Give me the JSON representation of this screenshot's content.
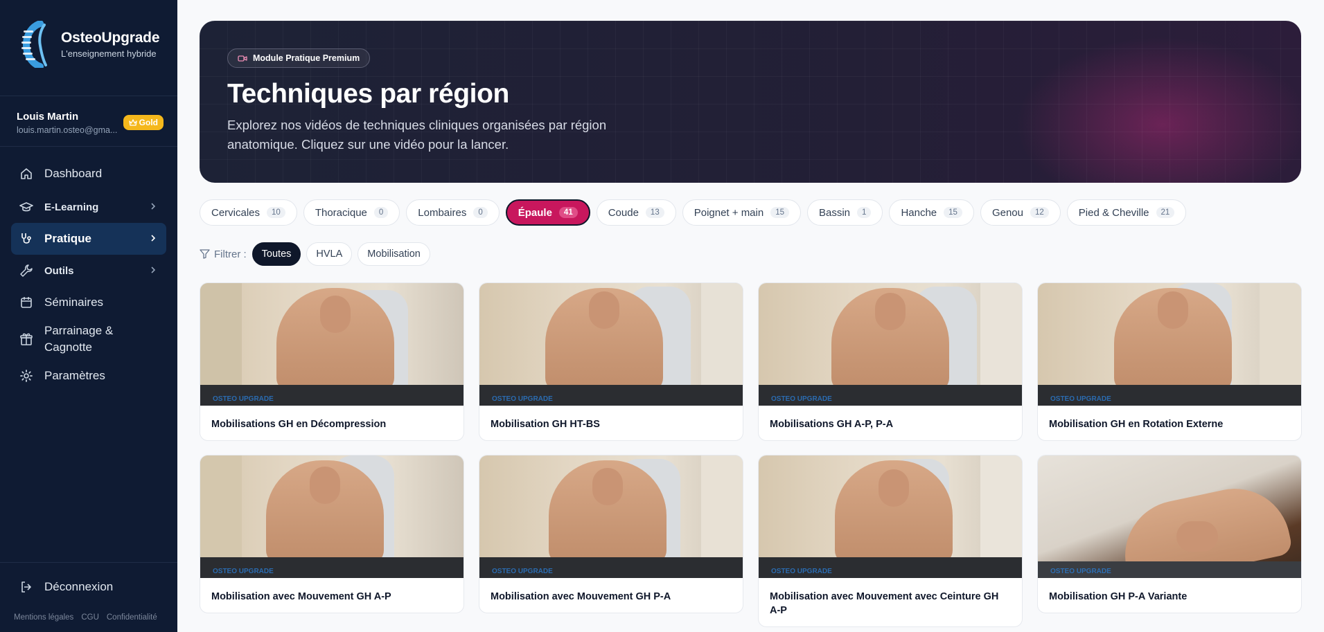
{
  "brand": {
    "name": "OsteoUpgrade",
    "tagline": "L'enseignement hybride"
  },
  "user": {
    "name": "Louis Martin",
    "email": "louis.martin.osteo@gma...",
    "badge": "Gold",
    "badge_color": "#f5b81c"
  },
  "nav": {
    "items": [
      {
        "label": "Dashboard"
      },
      {
        "label": "E-Learning"
      },
      {
        "label": "Pratique"
      },
      {
        "label": "Outils"
      },
      {
        "label": "Séminaires"
      },
      {
        "label": "Parrainage & Cagnotte"
      },
      {
        "label": "Paramètres"
      }
    ],
    "logout": "Déconnexion",
    "legal": [
      "Mentions légales",
      "CGU",
      "Confidentialité"
    ]
  },
  "hero": {
    "pill": "Module Pratique Premium",
    "title": "Techniques par région",
    "subtitle": "Explorez nos vidéos de techniques cliniques organisées par région anatomique. Cliquez sur une vidéo pour la lancer."
  },
  "regions": [
    {
      "label": "Cervicales",
      "count": "10"
    },
    {
      "label": "Thoracique",
      "count": "0"
    },
    {
      "label": "Lombaires",
      "count": "0"
    },
    {
      "label": "Épaule",
      "count": "41"
    },
    {
      "label": "Coude",
      "count": "13"
    },
    {
      "label": "Poignet + main",
      "count": "15"
    },
    {
      "label": "Bassin",
      "count": "1"
    },
    {
      "label": "Hanche",
      "count": "15"
    },
    {
      "label": "Genou",
      "count": "12"
    },
    {
      "label": "Pied & Cheville",
      "count": "21"
    }
  ],
  "active_region": "Épaule",
  "accent_color": "#c8175d",
  "filter": {
    "label": "Filtrer :",
    "options": [
      "Toutes",
      "HVLA",
      "Mobilisation"
    ],
    "selected": "Toutes"
  },
  "videos": [
    {
      "title": "Mobilisations GH en Décompression",
      "watermark": "OSTEO UPGRADE"
    },
    {
      "title": "Mobilisation GH HT-BS",
      "watermark": "OSTEO UPGRADE"
    },
    {
      "title": "Mobilisations GH A-P, P-A",
      "watermark": "OSTEO UPGRADE"
    },
    {
      "title": "Mobilisation GH en Rotation Externe",
      "watermark": "OSTEO UPGRADE"
    },
    {
      "title": "Mobilisation avec Mouvement GH A-P",
      "watermark": "OSTEO UPGRADE"
    },
    {
      "title": "Mobilisation avec Mouvement GH P-A",
      "watermark": "OSTEO UPGRADE"
    },
    {
      "title": "Mobilisation avec Mouvement avec Ceinture GH A-P",
      "watermark": "OSTEO UPGRADE"
    },
    {
      "title": "Mobilisation GH P-A Variante",
      "watermark": "OSTEO UPGRADE"
    }
  ]
}
